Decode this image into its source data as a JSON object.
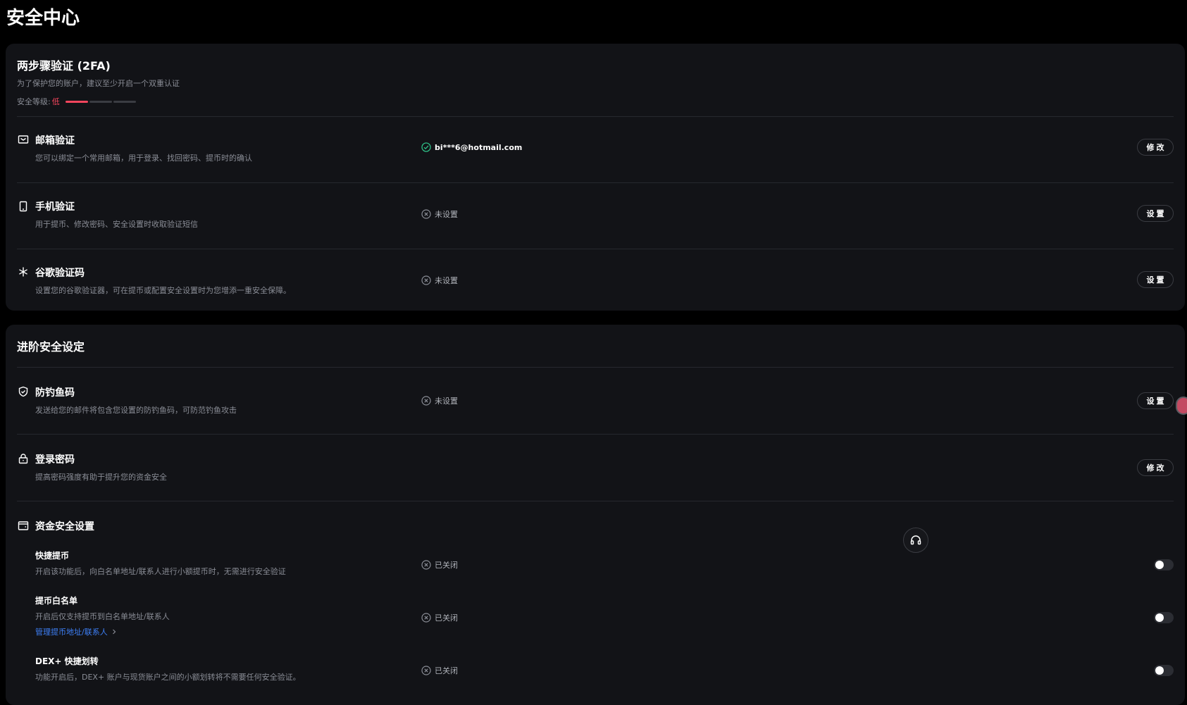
{
  "page": {
    "title": "安全中心"
  },
  "twofa": {
    "title": "两步骤验证 (2FA)",
    "subtitle": "为了保护您的账户，建议至少开启一个双重认证",
    "level_label": "安全等级:",
    "level_value": "低",
    "level_filled": 1,
    "level_total": 3,
    "items": [
      {
        "icon": "envelope-icon",
        "title": "邮箱验证",
        "desc": "您可以绑定一个常用邮箱，用于登录、找回密码、提币时的确认",
        "status": "bi***6@hotmail.com",
        "status_state": "verified",
        "button": "修改"
      },
      {
        "icon": "phone-icon",
        "title": "手机验证",
        "desc": "用于提币、修改密码、安全设置时收取验证短信",
        "status": "未设置",
        "status_state": "unset",
        "button": "设置"
      },
      {
        "icon": "asterisk-icon",
        "title": "谷歌验证码",
        "desc": "设置您的谷歌验证器，可在提币或配置安全设置时为您增添一重安全保障。",
        "status": "未设置",
        "status_state": "unset",
        "button": "设置"
      }
    ]
  },
  "advanced": {
    "title": "进阶安全设定",
    "anti_phishing": {
      "icon": "shield-check-icon",
      "title": "防钓鱼码",
      "desc": "发送给您的邮件将包含您设置的防钓鱼码，可防范钓鱼攻击",
      "status": "未设置",
      "button": "设置"
    },
    "login_password": {
      "icon": "lock-icon",
      "title": "登录密码",
      "desc": "提高密码强度有助于提升您的资金安全",
      "button": "修改"
    },
    "funds": {
      "icon": "wallet-icon",
      "title": "资金安全设置",
      "items": [
        {
          "title": "快捷提币",
          "desc": "开启该功能后，向白名单地址/联系人进行小额提币时，无需进行安全验证",
          "status": "已关闭",
          "enabled": false
        },
        {
          "title": "提币白名单",
          "desc": "开启后仅支持提币到白名单地址/联系人",
          "link": "管理提币地址/联系人",
          "status": "已关闭",
          "enabled": false
        },
        {
          "title": "DEX+ 快捷划转",
          "desc": "功能开启后，DEX+ 账户与现货账户之间的小额划转将不需要任何安全验证。",
          "status": "已关闭",
          "enabled": false
        }
      ]
    }
  },
  "floating": {
    "support_icon": "headset-icon"
  },
  "colors": {
    "background": "#000000",
    "card": "#121317",
    "danger": "#f6465d",
    "success": "#2ebd85",
    "link": "#3d7ff6"
  }
}
